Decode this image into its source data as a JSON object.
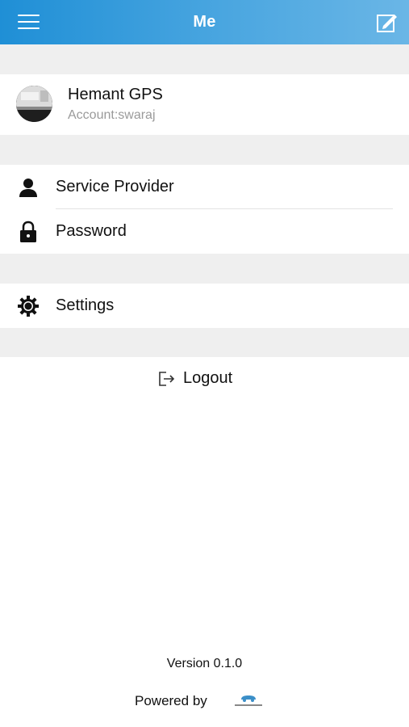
{
  "header": {
    "title": "Me"
  },
  "profile": {
    "name": "Hemant GPS",
    "account": "Account:swaraj"
  },
  "rows": {
    "service_provider": "Service Provider",
    "password": "Password",
    "settings": "Settings"
  },
  "logout": {
    "label": "Logout"
  },
  "footer": {
    "version": "Version 0.1.0",
    "powered_by": "Powered by"
  },
  "icons": {
    "menu": "hamburger-menu-icon",
    "edit": "edit-icon",
    "user": "user-icon",
    "lock": "lock-icon",
    "gear": "gear-icon",
    "logout": "logout-icon"
  },
  "colors": {
    "header_start": "#1f8fd6",
    "header_end": "#6ab6e6",
    "section_gap": "#efefef",
    "muted_text": "#9a9a9a"
  }
}
